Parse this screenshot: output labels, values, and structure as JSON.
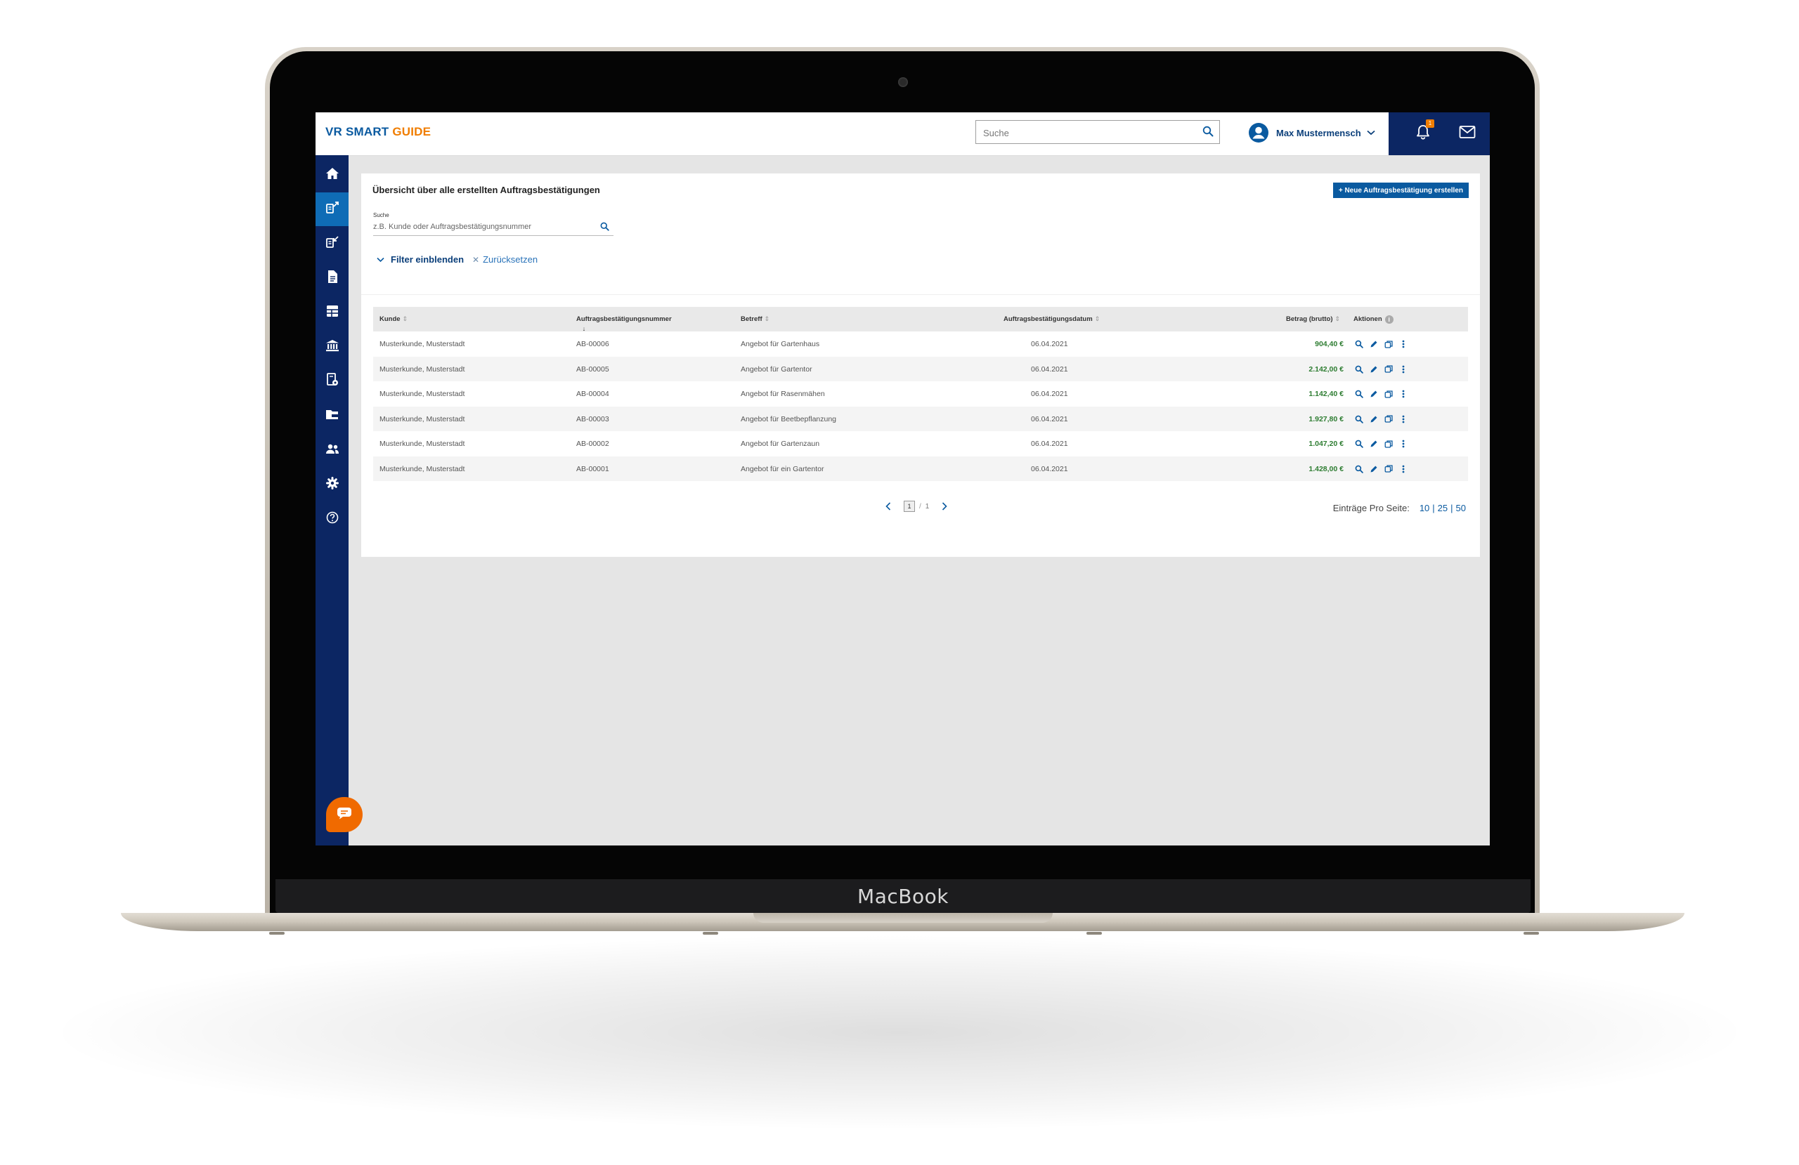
{
  "device": {
    "brand": "MacBook"
  },
  "header": {
    "logo_part1": "VR SMART",
    "logo_part2": "GUIDE",
    "search_placeholder": "Suche",
    "user_name": "Max Mustermensch",
    "notification_count": "1"
  },
  "sidebar": {
    "items": [
      {
        "icon": "home-icon",
        "active": false
      },
      {
        "icon": "outgoing-document-icon",
        "active": true
      },
      {
        "icon": "incoming-document-icon",
        "active": false
      },
      {
        "icon": "file-icon",
        "active": false
      },
      {
        "icon": "table-icon",
        "active": false
      },
      {
        "icon": "bank-icon",
        "active": false
      },
      {
        "icon": "document-settings-icon",
        "active": false
      },
      {
        "icon": "folder-icon",
        "active": false
      },
      {
        "icon": "users-icon",
        "active": false
      },
      {
        "icon": "gear-icon",
        "active": false
      },
      {
        "icon": "help-icon",
        "active": false
      }
    ]
  },
  "main": {
    "title": "Übersicht über alle erstellten Auftragsbestätigungen",
    "new_button": "+ Neue Auftragsbestätigung erstellen",
    "search_label": "Suche",
    "search_placeholder": "z.B. Kunde oder Auftragsbestätigungsnummer",
    "filter_toggle": "Filter einblenden",
    "reset": "Zurücksetzen",
    "table": {
      "headers": {
        "kunde": "Kunde",
        "nummer": "Auftragsbestätigungsnummer",
        "betreff": "Betreff",
        "datum": "Auftragsbestätigungsdatum",
        "betrag": "Betrag (brutto)",
        "aktionen": "Aktionen"
      },
      "rows": [
        {
          "kunde": "Musterkunde, Musterstadt",
          "nummer": "AB-00006",
          "betreff": "Angebot für Gartenhaus",
          "datum": "06.04.2021",
          "betrag": "904,40 €"
        },
        {
          "kunde": "Musterkunde, Musterstadt",
          "nummer": "AB-00005",
          "betreff": "Angebot für Gartentor",
          "datum": "06.04.2021",
          "betrag": "2.142,00 €"
        },
        {
          "kunde": "Musterkunde, Musterstadt",
          "nummer": "AB-00004",
          "betreff": "Angebot für Rasenmähen",
          "datum": "06.04.2021",
          "betrag": "1.142,40 €"
        },
        {
          "kunde": "Musterkunde, Musterstadt",
          "nummer": "AB-00003",
          "betreff": "Angebot für Beetbepflanzung",
          "datum": "06.04.2021",
          "betrag": "1.927,80 €"
        },
        {
          "kunde": "Musterkunde, Musterstadt",
          "nummer": "AB-00002",
          "betreff": "Angebot für Gartenzaun",
          "datum": "06.04.2021",
          "betrag": "1.047,20 €"
        },
        {
          "kunde": "Musterkunde, Musterstadt",
          "nummer": "AB-00001",
          "betreff": "Angebot für ein Gartentor",
          "datum": "06.04.2021",
          "betrag": "1.428,00 €"
        }
      ]
    },
    "pagination": {
      "current": "1",
      "separator": "/",
      "total": "1",
      "per_page_label": "Einträge Pro Seite:",
      "per_page_options": [
        "10",
        "25",
        "50"
      ]
    }
  },
  "colors": {
    "brand_blue": "#0a5aa0",
    "brand_orange": "#f07d00",
    "navy": "#0c2663",
    "sidebar_active": "#0f6cb6",
    "amount_green": "#2e7d32",
    "chat_orange": "#f06a00"
  }
}
